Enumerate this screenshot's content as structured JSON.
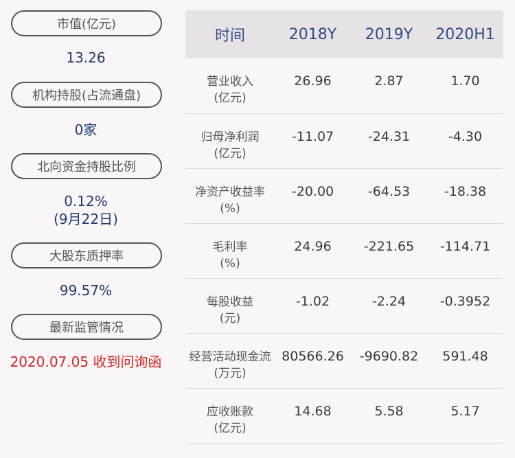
{
  "left": {
    "market_cap_label": "市值(亿元)",
    "market_cap_value": "13.26",
    "inst_holding_label": "机构持股(占流通盘)",
    "inst_holding_value": "0家",
    "northbound_label": "北向资金持股比例",
    "northbound_value": "0.12%",
    "northbound_date": "(9月22日)",
    "pledge_label": "大股东质押率",
    "pledge_value": "99.57%",
    "regulatory_label": "最新监管情况",
    "regulatory_value": "2020.07.05 收到问询函"
  },
  "table": {
    "headers": [
      "时间",
      "2018Y",
      "2019Y",
      "2020H1"
    ],
    "rows": [
      {
        "label1": "营业收入",
        "label2": "(亿元)",
        "v": [
          "26.96",
          "2.87",
          "1.70"
        ]
      },
      {
        "label1": "归母净利润",
        "label2": "(亿元)",
        "v": [
          "-11.07",
          "-24.31",
          "-4.30"
        ]
      },
      {
        "label1": "净资产收益率",
        "label2": "(%)",
        "v": [
          "-20.00",
          "-64.53",
          "-18.38"
        ]
      },
      {
        "label1": "毛利率",
        "label2": "(%)",
        "v": [
          "24.96",
          "-221.65",
          "-114.71"
        ]
      },
      {
        "label1": "每股收益",
        "label2": "(元)",
        "v": [
          "-1.02",
          "-2.24",
          "-0.3952"
        ]
      },
      {
        "label1": "经营活动现金流",
        "label2": "(万元)",
        "v": [
          "80566.26",
          "-9690.82",
          "591.48"
        ]
      },
      {
        "label1": "应收账款",
        "label2": "(亿元)",
        "v": [
          "14.68",
          "5.58",
          "5.17"
        ]
      }
    ]
  },
  "colors": {
    "value_blue": "#1f3c73",
    "header_blue": "#2e4b86",
    "alert_red": "#d02626",
    "header_bg": "#e7e3e5"
  }
}
